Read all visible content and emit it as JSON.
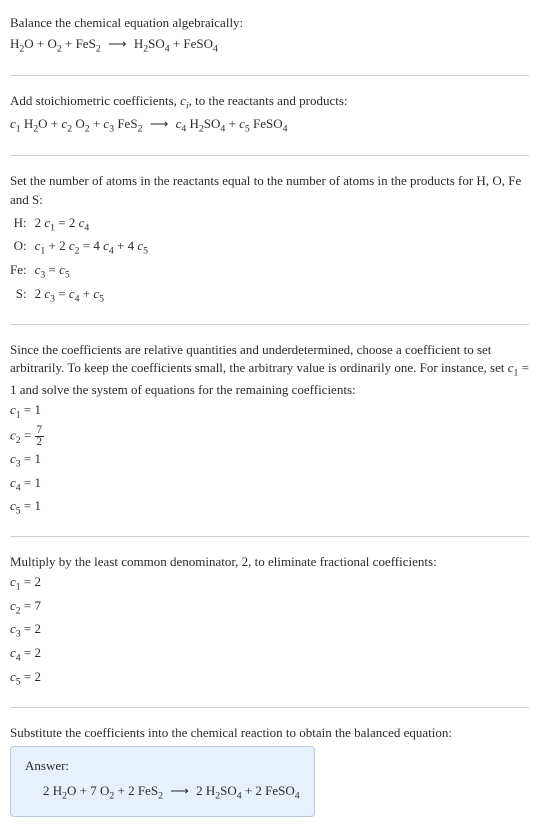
{
  "section1": {
    "title": "Balance the chemical equation algebraically:",
    "equation": "H₂O + O₂ + FeS₂  ⟶  H₂SO₄ + FeSO₄"
  },
  "section2": {
    "title_pre": "Add stoichiometric coefficients, ",
    "title_ci": "c",
    "title_ci_sub": "i",
    "title_post": ", to the reactants and products:",
    "equation": "c₁ H₂O + c₂ O₂ + c₃ FeS₂  ⟶  c₄ H₂SO₄ + c₅ FeSO₄"
  },
  "section3": {
    "title": "Set the number of atoms in the reactants equal to the number of atoms in the products for H, O, Fe and S:",
    "rows": [
      {
        "elem": "H:",
        "eq": "2 c₁ = 2 c₄"
      },
      {
        "elem": "O:",
        "eq": "c₁ + 2 c₂ = 4 c₄ + 4 c₅"
      },
      {
        "elem": "Fe:",
        "eq": "c₃ = c₅"
      },
      {
        "elem": "S:",
        "eq": "2 c₃ = c₄ + c₅"
      }
    ]
  },
  "section4": {
    "text": "Since the coefficients are relative quantities and underdetermined, choose a coefficient to set arbitrarily. To keep the coefficients small, the arbitrary value is ordinarily one. For instance, set c₁ = 1 and solve the system of equations for the remaining coefficients:",
    "coeffs": [
      {
        "lhs": "c₁ = ",
        "rhs": "1"
      },
      {
        "lhs": "c₂ = ",
        "frac_num": "7",
        "frac_den": "2"
      },
      {
        "lhs": "c₃ = ",
        "rhs": "1"
      },
      {
        "lhs": "c₄ = ",
        "rhs": "1"
      },
      {
        "lhs": "c₅ = ",
        "rhs": "1"
      }
    ]
  },
  "section5": {
    "text": "Multiply by the least common denominator, 2, to eliminate fractional coefficients:",
    "coeffs": [
      {
        "lhs": "c₁ = ",
        "rhs": "2"
      },
      {
        "lhs": "c₂ = ",
        "rhs": "7"
      },
      {
        "lhs": "c₃ = ",
        "rhs": "2"
      },
      {
        "lhs": "c₄ = ",
        "rhs": "2"
      },
      {
        "lhs": "c₅ = ",
        "rhs": "2"
      }
    ]
  },
  "section6": {
    "text": "Substitute the coefficients into the chemical reaction to obtain the balanced equation:",
    "answer_label": "Answer:",
    "answer_eq": "2 H₂O + 7 O₂ + 2 FeS₂  ⟶  2 H₂SO₄ + 2 FeSO₄"
  }
}
